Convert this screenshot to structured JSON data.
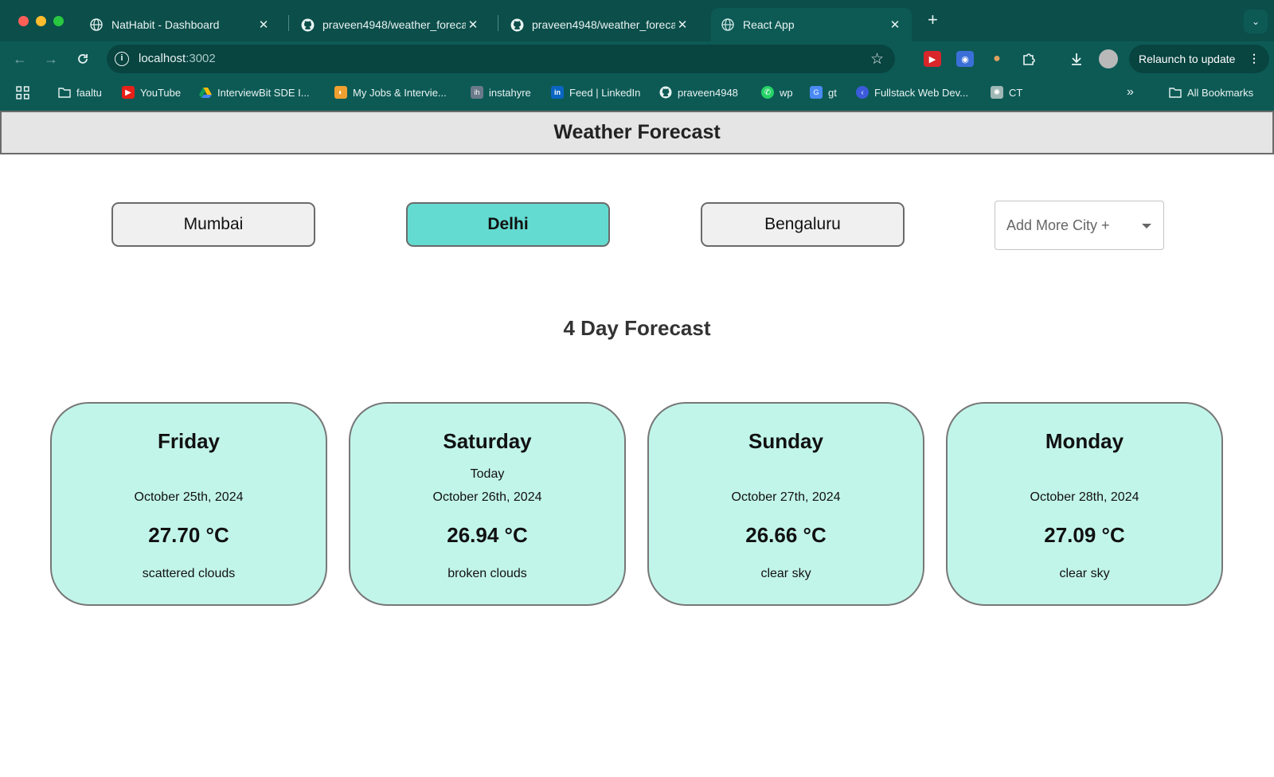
{
  "browser": {
    "tabs": [
      {
        "title": "NatHabit - Dashboard",
        "active": false,
        "icon": "globe-icon"
      },
      {
        "title": "praveen4948/weather_foreca",
        "active": false,
        "icon": "github-icon"
      },
      {
        "title": "praveen4948/weather_foreca",
        "active": false,
        "icon": "github-icon"
      },
      {
        "title": "React App",
        "active": true,
        "icon": "globe-icon"
      }
    ],
    "url_host": "localhost",
    "url_port": ":3002",
    "relaunch_label": "Relaunch to update",
    "bookmarks": [
      {
        "label": "faaltu",
        "icon": "folder-icon"
      },
      {
        "label": "YouTube",
        "icon": "youtube-icon"
      },
      {
        "label": "InterviewBit SDE I...",
        "icon": "drive-icon"
      },
      {
        "label": "My Jobs & Intervie...",
        "icon": "jobs-icon"
      },
      {
        "label": "instahyre",
        "icon": "instahyre-icon"
      },
      {
        "label": "Feed | LinkedIn",
        "icon": "linkedin-icon"
      },
      {
        "label": "praveen4948",
        "icon": "github-icon"
      },
      {
        "label": "wp",
        "icon": "whatsapp-icon"
      },
      {
        "label": "gt",
        "icon": "translate-icon"
      },
      {
        "label": "Fullstack Web Dev...",
        "icon": "course-icon"
      },
      {
        "label": "CT",
        "icon": "chatgpt-icon"
      }
    ],
    "all_bookmarks_label": "All Bookmarks",
    "colors": {
      "frame": "#0b4e4a",
      "toolbar": "#0d5a55"
    }
  },
  "app": {
    "title": "Weather Forecast",
    "cities": [
      {
        "name": "Mumbai",
        "selected": false
      },
      {
        "name": "Delhi",
        "selected": true
      },
      {
        "name": "Bengaluru",
        "selected": false
      }
    ],
    "add_city_placeholder": "Add More City +",
    "forecast_title": "4 Day Forecast",
    "forecast": [
      {
        "day": "Friday",
        "today_label": "",
        "date": "October 25th, 2024",
        "temp": "27.70 °C",
        "desc": "scattered clouds"
      },
      {
        "day": "Saturday",
        "today_label": "Today",
        "date": "October 26th, 2024",
        "temp": "26.94 °C",
        "desc": "broken clouds"
      },
      {
        "day": "Sunday",
        "today_label": "",
        "date": "October 27th, 2024",
        "temp": "26.66 °C",
        "desc": "clear sky"
      },
      {
        "day": "Monday",
        "today_label": "",
        "date": "October 28th, 2024",
        "temp": "27.09 °C",
        "desc": "clear sky"
      }
    ],
    "colors": {
      "selected_city": "#64dbd1",
      "card_bg": "#c2f5ea",
      "header_bg": "#e5e5e5"
    }
  }
}
